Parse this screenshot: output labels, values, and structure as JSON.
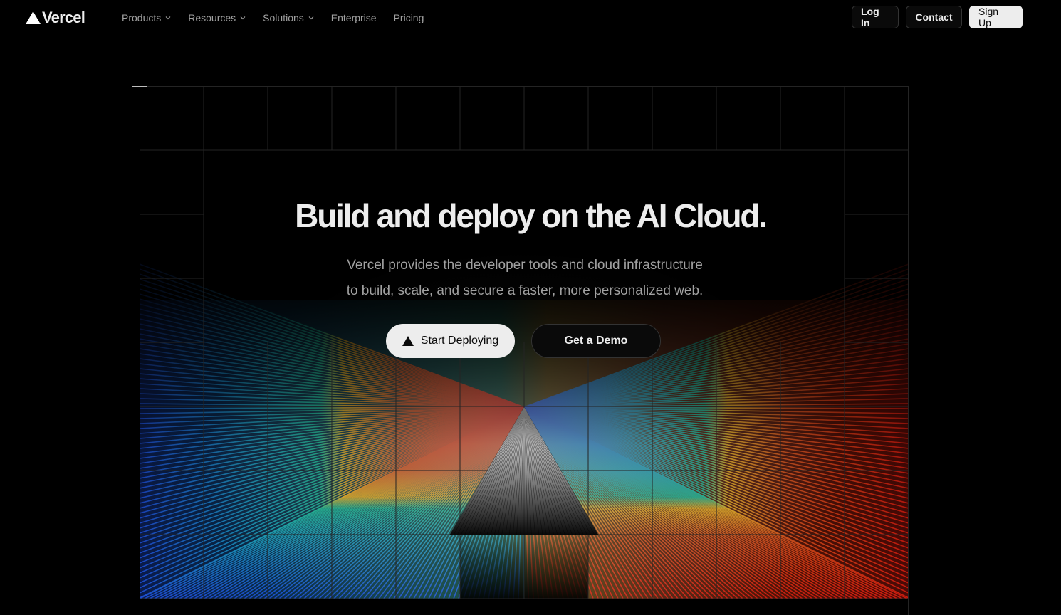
{
  "header": {
    "logo_text": "Vercel",
    "nav": [
      {
        "label": "Products",
        "has_dropdown": true
      },
      {
        "label": "Resources",
        "has_dropdown": true
      },
      {
        "label": "Solutions",
        "has_dropdown": true
      },
      {
        "label": "Enterprise",
        "has_dropdown": false
      },
      {
        "label": "Pricing",
        "has_dropdown": false
      }
    ],
    "login_label": "Log In",
    "contact_label": "Contact",
    "signup_label": "Sign Up"
  },
  "hero": {
    "headline": "Build and deploy on the AI Cloud.",
    "subline_1": "Vercel provides the developer tools and cloud infrastructure",
    "subline_2": "to build, scale, and secure a faster, more personalized web.",
    "primary_cta": "Start Deploying",
    "secondary_cta": "Get a Demo"
  },
  "colors": {
    "background": "#000000",
    "text_primary": "#ededed",
    "text_secondary": "#a1a1a1",
    "grid_line": "#1f1f1f",
    "spectrum": [
      "#1e4fd8",
      "#18c29a",
      "#f2b51d",
      "#d81c10"
    ]
  },
  "icons": {
    "logo": "vercel-triangle-icon",
    "nav_dropdown": "chevron-down-icon",
    "cta": "triangle-icon",
    "corner": "plus-icon"
  }
}
